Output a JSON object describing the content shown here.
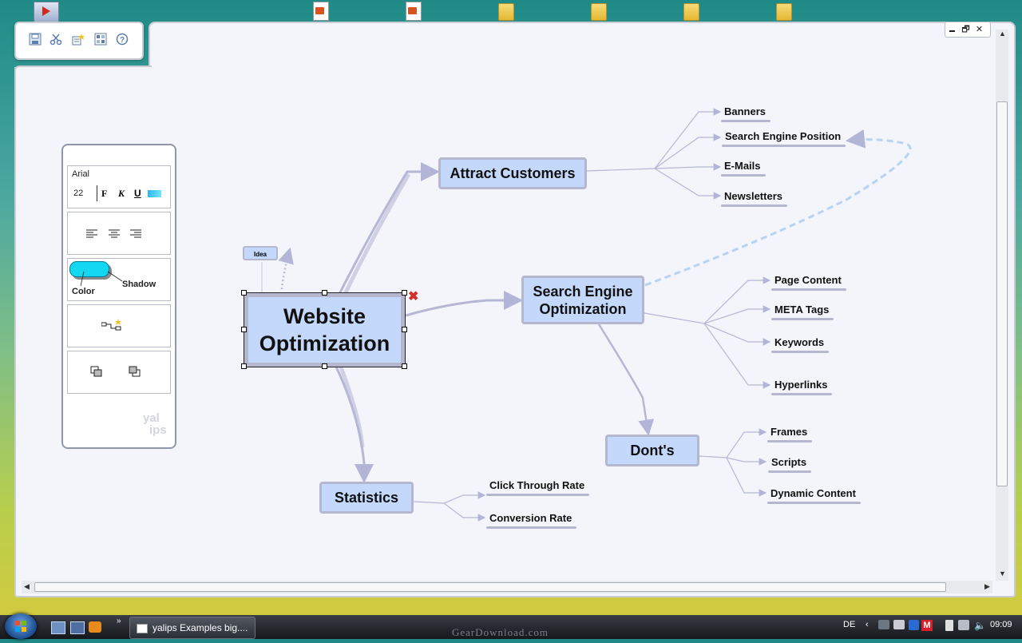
{
  "desktop": {
    "icons": [
      "ppt-file-icon",
      "ppt-file-icon",
      "folder-icon",
      "folder-icon",
      "folder-icon",
      "folder-icon"
    ]
  },
  "toolbar": {
    "buttons": [
      "save-icon",
      "cut-icon",
      "new-node-icon",
      "layout-icon",
      "help-icon"
    ]
  },
  "window_controls": {
    "minimize": "▬",
    "restore": "🗗",
    "close": "✕"
  },
  "format_panel": {
    "font_name": "Arial",
    "font_size": "22",
    "bold": "F",
    "italic": "K",
    "underline": "U",
    "color_label": "Color",
    "shadow_label": "Shadow",
    "logo_top": "yal",
    "logo_bottom": "ips"
  },
  "mindmap": {
    "central": "Website Optimization",
    "idea_label": "Idea",
    "branches": {
      "attract": "Attract Customers",
      "seo_line1": "Search Engine",
      "seo_line2": "Optimization",
      "donts": "Dont's",
      "statistics": "Statistics"
    },
    "leaves": {
      "banners": "Banners",
      "search_engine_position": "Search Engine Position",
      "emails": "E-Mails",
      "newsletters": "Newsletters",
      "page_content": "Page Content",
      "meta_tags": "META Tags",
      "keywords": "Keywords",
      "hyperlinks": "Hyperlinks",
      "frames": "Frames",
      "scripts": "Scripts",
      "dynamic_content": "Dynamic Content",
      "click_through_rate": "Click Through Rate",
      "conversion_rate": "Conversion Rate"
    }
  },
  "taskbar": {
    "task_label": "yalips Examples big....",
    "language": "DE",
    "time": "09:09",
    "watermark": "GearDownload.com"
  },
  "colors": {
    "node_fill": "#c3d8fb",
    "node_border": "#b5b7cf",
    "connector": "#b5b7d4",
    "dashed_link": "#b7d3f3",
    "delete": "#d4302a"
  }
}
